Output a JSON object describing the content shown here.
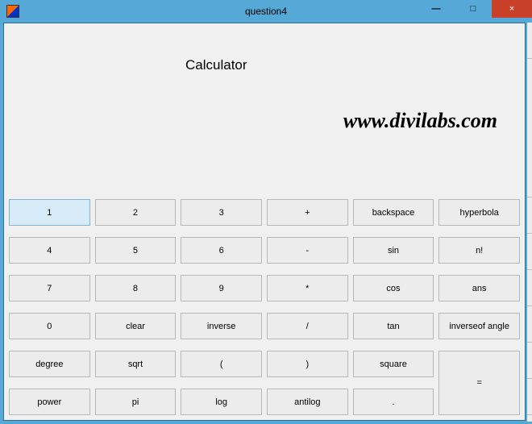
{
  "window": {
    "title": "question4",
    "minimize": "—",
    "maximize": "□",
    "close": "×"
  },
  "heading": "Calculator",
  "watermark": "www.divilabs.com",
  "buttons": {
    "r1c1": "1",
    "r1c2": "2",
    "r1c3": "3",
    "r1c4": "+",
    "r1c5": "backspace",
    "r1c6": "hyperbola",
    "r2c1": "4",
    "r2c2": "5",
    "r2c3": "6",
    "r2c4": "-",
    "r2c5": "sin",
    "r2c6": "n!",
    "r3c1": "7",
    "r3c2": "8",
    "r3c3": "9",
    "r3c4": "*",
    "r3c5": "cos",
    "r3c6": "ans",
    "r4c1": "0",
    "r4c2": "clear",
    "r4c3": "inverse",
    "r4c4": "/",
    "r4c5": "tan",
    "r4c6": "inverseof angle",
    "r5c1": "degree",
    "r5c2": "sqrt",
    "r5c3": "(",
    "r5c4": ")",
    "r5c5": "square",
    "r6c1": "power",
    "r6c2": "pi",
    "r6c3": "log",
    "r6c4": "antilog",
    "r6c5": ".",
    "equals": "="
  }
}
